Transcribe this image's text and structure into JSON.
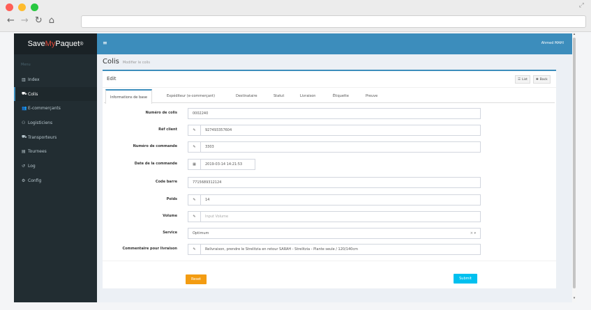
{
  "brand": {
    "name_part1": "Save",
    "name_accent": "My",
    "name_part2": "Paquet",
    "trademark": "®"
  },
  "sidebar": {
    "menu_title": "Menu",
    "items": [
      {
        "icon": "bar-chart-icon",
        "glyph": "▥",
        "label": "Index"
      },
      {
        "icon": "cart-icon",
        "glyph": "⛟",
        "label": "Colis"
      },
      {
        "icon": "users-icon",
        "glyph": "👥",
        "label": "E-commerçants"
      },
      {
        "icon": "handshake-icon",
        "glyph": "⚇",
        "label": "Logisticiens"
      },
      {
        "icon": "truck-icon",
        "glyph": "⛟",
        "label": "Transporteurs"
      },
      {
        "icon": "map-icon",
        "glyph": "▤",
        "label": "Tournees"
      },
      {
        "icon": "history-icon",
        "glyph": "↺",
        "label": "Log"
      },
      {
        "icon": "cogs-icon",
        "glyph": "⚙",
        "label": "Config"
      }
    ],
    "active_index": 1
  },
  "topbar": {
    "menu_icon": "≡",
    "user_name": "Ahmed MAHI"
  },
  "page": {
    "title": "Colis",
    "subtitle": "Modifier le colis"
  },
  "box": {
    "title": "Edit",
    "list_label": "List",
    "back_label": "Back"
  },
  "tabs": [
    "Informations de base",
    "Expéditeur (e-commerçant)",
    "Destinataire",
    "Statut",
    "Livraison",
    "Étiquette",
    "Preuve"
  ],
  "form": {
    "numero_colis": {
      "label": "Numéro de colis",
      "value": "0002240"
    },
    "ref_client": {
      "label": "Réf client",
      "value": "927493357604"
    },
    "numero_commande": {
      "label": "Numéro de commande",
      "value": "3303"
    },
    "date_commande": {
      "label": "Date de la commande",
      "value": "2019-03-14 14:21:53"
    },
    "code_barre": {
      "label": "Code barre",
      "value": "7715689312124"
    },
    "poids": {
      "label": "Poids",
      "value": "14"
    },
    "volume": {
      "label": "Volume",
      "placeholder": "Input Volume"
    },
    "service": {
      "label": "Service",
      "value": "Optimum"
    },
    "commentaire": {
      "label": "Commentaire pour livraison",
      "value": "Relivraison, prendre le Strelitzia en retour SARAH - Strelitzia - Plante seule / 120/140cm"
    }
  },
  "buttons": {
    "reset": "Reset",
    "submit": "Submit"
  },
  "colors": {
    "accent": "#3c8dbc",
    "reset": "#f39c12",
    "submit": "#00c0ef",
    "mac_red": "#ff5f57",
    "mac_yellow": "#febc2e",
    "mac_green": "#28c840"
  }
}
